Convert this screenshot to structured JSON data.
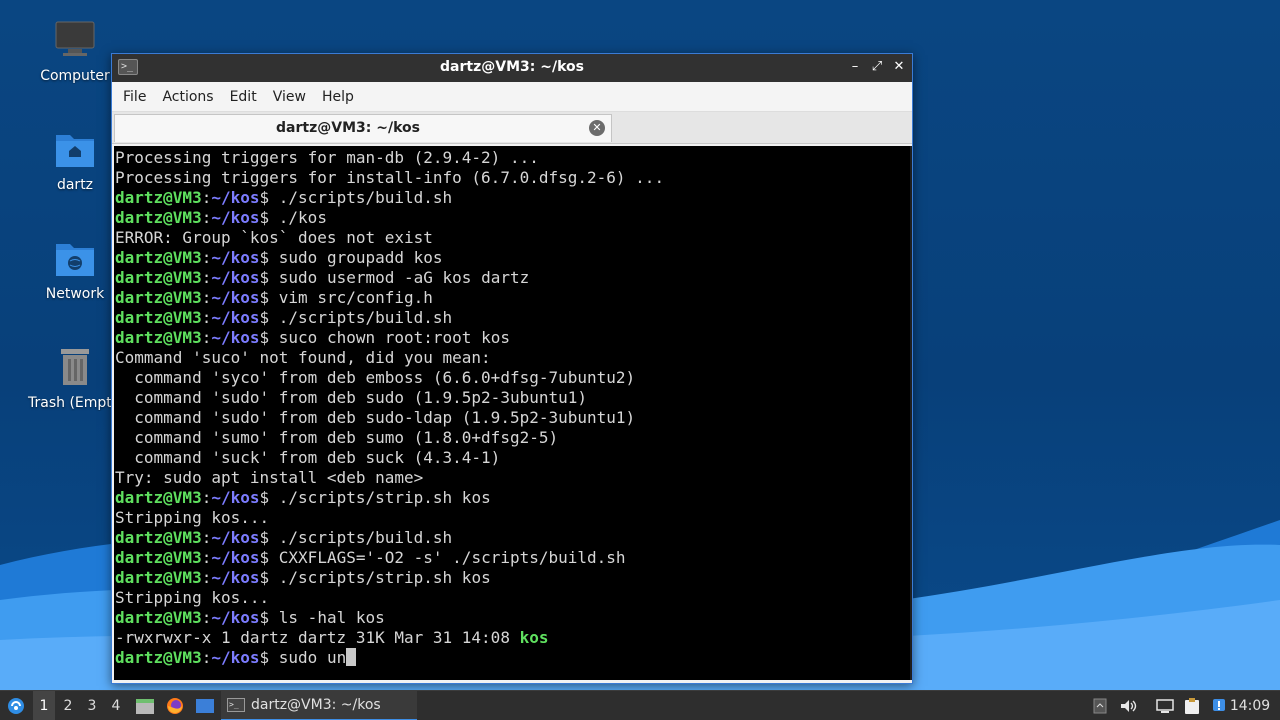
{
  "desktop": {
    "icons": [
      {
        "label": "Computer"
      },
      {
        "label": "dartz"
      },
      {
        "label": "Network"
      },
      {
        "label": "Trash (Empt"
      }
    ]
  },
  "window": {
    "title": "dartz@VM3: ~/kos",
    "controls": {
      "minimize": "–",
      "maximize": "⤢",
      "close": "✕"
    },
    "menu": [
      "File",
      "Actions",
      "Edit",
      "View",
      "Help"
    ],
    "tab": {
      "label": "dartz@VM3: ~/kos",
      "close": "✕"
    }
  },
  "terminal": {
    "prompt": {
      "user": "dartz@VM3",
      "colon": ":",
      "path": "~/kos",
      "symbol": "$ "
    },
    "lines": [
      {
        "type": "out",
        "text": "Processing triggers for man-db (2.9.4-2) ..."
      },
      {
        "type": "out",
        "text": "Processing triggers for install-info (6.7.0.dfsg.2-6) ..."
      },
      {
        "type": "cmd",
        "text": "./scripts/build.sh"
      },
      {
        "type": "cmd",
        "text": "./kos"
      },
      {
        "type": "out",
        "text": "ERROR: Group `kos` does not exist"
      },
      {
        "type": "cmd",
        "text": "sudo groupadd kos"
      },
      {
        "type": "cmd",
        "text": "sudo usermod -aG kos dartz"
      },
      {
        "type": "cmd",
        "text": "vim src/config.h"
      },
      {
        "type": "cmd",
        "text": "./scripts/build.sh"
      },
      {
        "type": "cmd",
        "text": "suco chown root:root kos"
      },
      {
        "type": "out",
        "text": "Command 'suco' not found, did you mean:"
      },
      {
        "type": "out",
        "text": "  command 'syco' from deb emboss (6.6.0+dfsg-7ubuntu2)"
      },
      {
        "type": "out",
        "text": "  command 'sudo' from deb sudo (1.9.5p2-3ubuntu1)"
      },
      {
        "type": "out",
        "text": "  command 'sudo' from deb sudo-ldap (1.9.5p2-3ubuntu1)"
      },
      {
        "type": "out",
        "text": "  command 'sumo' from deb sumo (1.8.0+dfsg2-5)"
      },
      {
        "type": "out",
        "text": "  command 'suck' from deb suck (4.3.4-1)"
      },
      {
        "type": "out",
        "text": "Try: sudo apt install <deb name>"
      },
      {
        "type": "cmd",
        "text": "./scripts/strip.sh kos"
      },
      {
        "type": "out",
        "text": "Stripping kos..."
      },
      {
        "type": "cmd",
        "text": "./scripts/build.sh"
      },
      {
        "type": "cmd",
        "text": "CXXFLAGS='-O2 -s' ./scripts/build.sh"
      },
      {
        "type": "cmd",
        "text": "./scripts/strip.sh kos"
      },
      {
        "type": "out",
        "text": "Stripping kos..."
      },
      {
        "type": "cmd",
        "text": "ls -hal kos"
      },
      {
        "type": "ls",
        "text": "-rwxrwxr-x 1 dartz dartz 31K Mar 31 14:08 ",
        "exe": "kos"
      },
      {
        "type": "input",
        "text": "sudo un"
      }
    ]
  },
  "taskbar": {
    "workspaces": [
      "1",
      "2",
      "3",
      "4"
    ],
    "active_workspace": "1",
    "task_label": "dartz@VM3: ~/kos",
    "clock": "14:09"
  },
  "colors": {
    "prompt_user": "#5fe05f",
    "prompt_path": "#7c7cff",
    "terminal_bg": "#000000",
    "accent": "#3d8ee6"
  }
}
